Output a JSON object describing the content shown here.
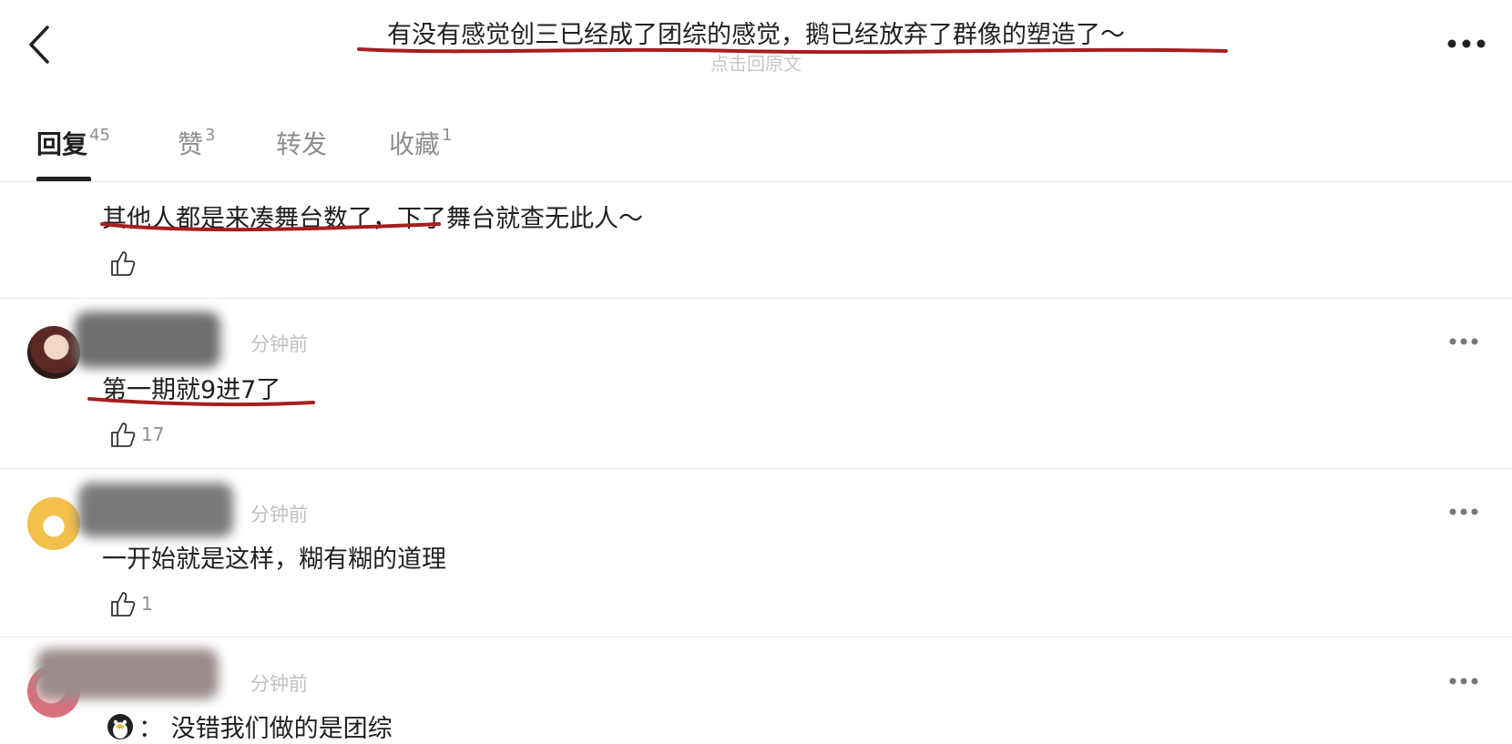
{
  "header": {
    "title": "有没有感觉创三已经成了团综的感觉，鹅已经放弃了群像的塑造了～",
    "subtitle": "点击回原文"
  },
  "tabs": [
    {
      "label": "回复",
      "count": "45"
    },
    {
      "label": "赞",
      "count": "3"
    },
    {
      "label": "转发",
      "count": ""
    },
    {
      "label": "收藏",
      "count": "1"
    }
  ],
  "comments": [
    {
      "text": "其他人都是来凑舞台数了，下了舞台就查无此人～",
      "likes": ""
    },
    {
      "time": "分钟前",
      "text": "第一期就9进7了",
      "likes": "17"
    },
    {
      "time": "分钟前",
      "text": "一开始就是这样，糊有糊的道理",
      "likes": "1"
    },
    {
      "time": "分钟前",
      "text": "：  没错我们做的是团综",
      "likes": ""
    }
  ],
  "colors": {
    "underline": "#a61e1e",
    "muted": "#8e8e8e",
    "divider": "#e8e8e8"
  }
}
